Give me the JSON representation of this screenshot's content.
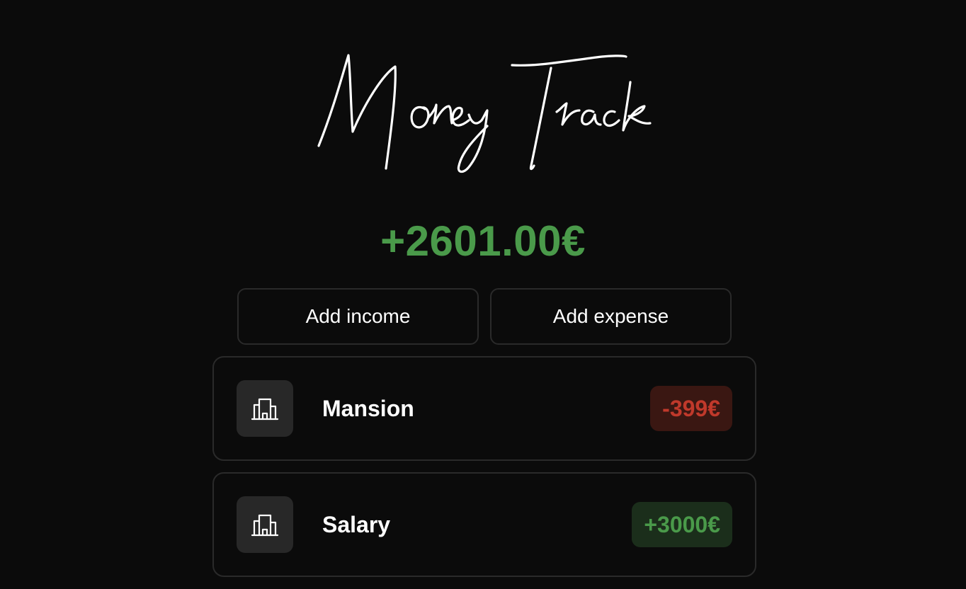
{
  "app": {
    "logo_text": "Money Track"
  },
  "balance": {
    "value": "+2601.00€",
    "color": "#4a9a4a"
  },
  "actions": {
    "add_income_label": "Add income",
    "add_expense_label": "Add expense"
  },
  "transactions": [
    {
      "title": "Mansion",
      "amount": "-399€",
      "type": "expense",
      "icon": "building-icon",
      "amount_color": "#c0392b",
      "badge_color": "#3a1712"
    },
    {
      "title": "Salary",
      "amount": "+3000€",
      "type": "income",
      "icon": "building-icon",
      "amount_color": "#4a9a4a",
      "badge_color": "#1b2e1b"
    }
  ]
}
